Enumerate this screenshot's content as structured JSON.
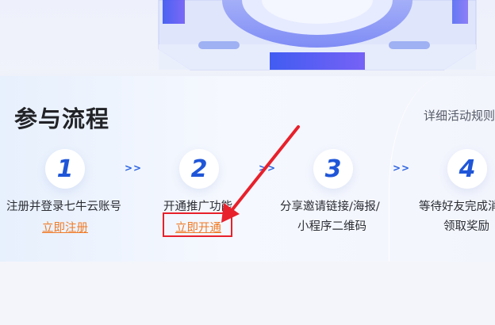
{
  "page": {
    "title": "参与流程",
    "rules_link": "详细活动规则"
  },
  "steps": [
    {
      "number": "1",
      "text": "注册并登录七牛云账号",
      "link": "立即注册"
    },
    {
      "number": "2",
      "text": "开通推广功能",
      "link": "立即开通"
    },
    {
      "number": "3",
      "text_line1": "分享邀请链接/海报/",
      "text_line2": "小程序二维码"
    },
    {
      "number": "4",
      "text_line1": "等待好友完成消费",
      "text_line2": "领取奖励"
    }
  ],
  "separator": ">>",
  "colors": {
    "accent": "#1f56d8",
    "link": "#f07b28",
    "annotation": "#e8202b"
  }
}
